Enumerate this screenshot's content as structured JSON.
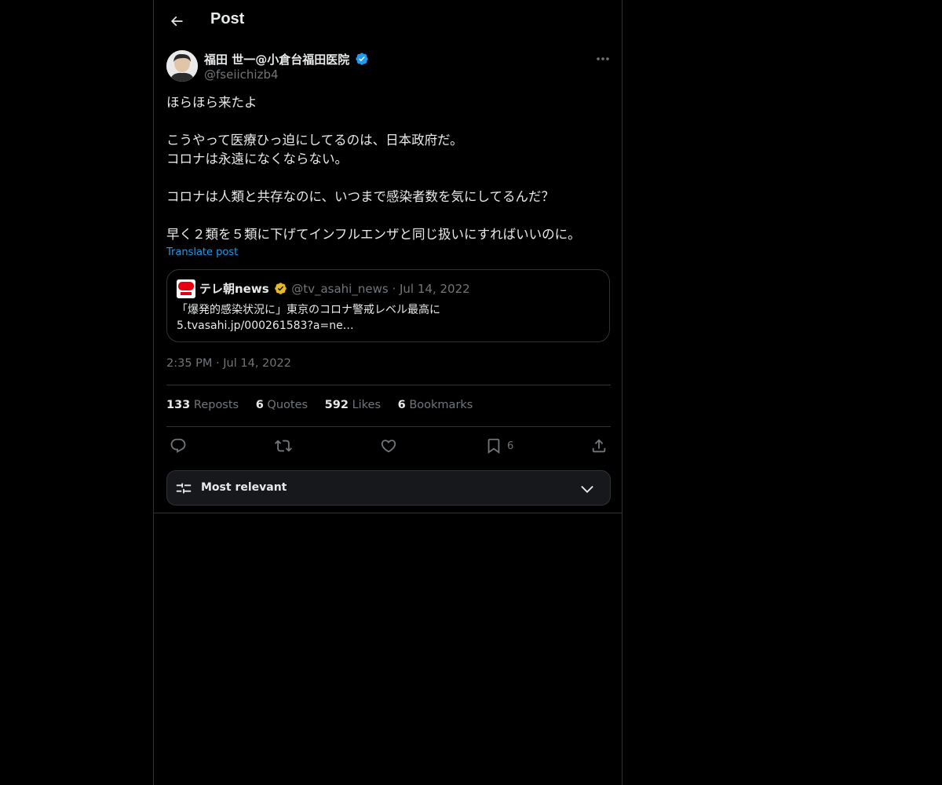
{
  "header": {
    "title": "Post",
    "back_icon": "arrow-left-icon"
  },
  "post": {
    "author_name": "福田 世一@小倉台福田医院",
    "handle": "@fseiichizb4",
    "verified_color": "#1d9bf0",
    "text": "ほらほら来たよ\n\nこうやって医療ひっ迫にしてるのは、日本政府だ。\nコロナは永遠になくならない。\n\nコロナは人類と共存なのに、いつまで感染者数を気にしてるんだ？\n\n早く２類を５類に下げてインフルエンザと同じ扱いにすればいいのに。",
    "translate_label": "Translate post",
    "timestamp_time": "2:35 PM",
    "timestamp_sep": "·",
    "timestamp_date": "Jul 14, 2022"
  },
  "quote": {
    "name": "テレ朝news",
    "verified_color": "#e8b829",
    "handle": "@tv_asahi_news",
    "sep": "·",
    "date": "Jul 14, 2022",
    "text": "「爆発的感染状況に」東京のコロナ警戒レベル最高に\n5.tvasahi.jp/000261583?a=ne…",
    "logo_text": "テレ朝\nnews"
  },
  "stats": [
    {
      "count": "133",
      "label": "Reposts"
    },
    {
      "count": "6",
      "label": "Quotes"
    },
    {
      "count": "592",
      "label": "Likes"
    },
    {
      "count": "6",
      "label": "Bookmarks"
    }
  ],
  "actions": {
    "reply_icon": "reply-icon",
    "repost_icon": "repost-icon",
    "like_icon": "heart-icon",
    "bookmark_icon": "bookmark-icon",
    "bookmark_count": "6",
    "share_icon": "share-icon"
  },
  "sort": {
    "label": "Most relevant"
  },
  "colors": {
    "background": "#000000",
    "border": "#2f3336",
    "muted": "#71767b",
    "accent": "#1d9bf0"
  }
}
